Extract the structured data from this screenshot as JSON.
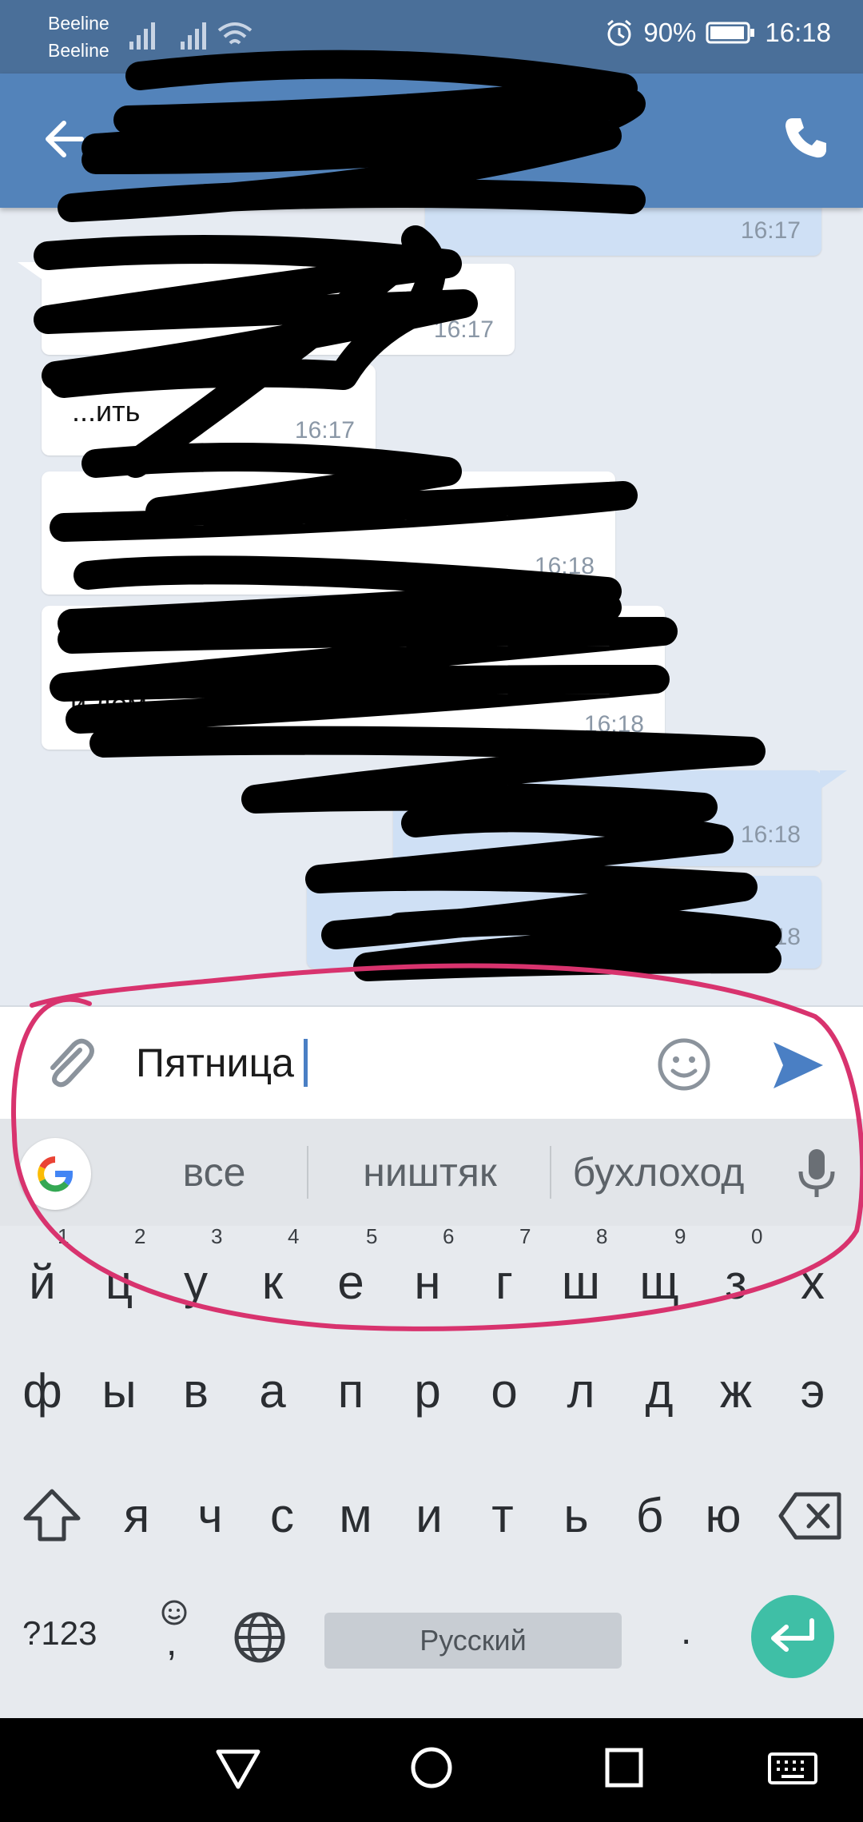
{
  "status_bar": {
    "carrier_1": "Beeline",
    "carrier_2": "Beeline",
    "battery": "90%",
    "time": "16:18"
  },
  "chat": {
    "messages": [
      {
        "type": "outgoing",
        "time": "16:17"
      },
      {
        "type": "incoming",
        "time": "16:17"
      },
      {
        "type": "incoming",
        "text": "...ить",
        "time": "16:17"
      },
      {
        "type": "incoming",
        "time": "16:18"
      },
      {
        "type": "incoming",
        "text": "и дом...",
        "time": "16:18"
      },
      {
        "type": "outgoing",
        "time": "16:18"
      },
      {
        "type": "outgoing",
        "time": "16:18"
      }
    ]
  },
  "composer": {
    "message_text": "Пятница"
  },
  "suggestions": [
    "все",
    "ништяк",
    "бухлоход"
  ],
  "keyboard": {
    "row1": [
      "й",
      "ц",
      "у",
      "к",
      "е",
      "н",
      "г",
      "ш",
      "щ",
      "з",
      "х"
    ],
    "row1_hints": [
      "1",
      "2",
      "3",
      "4",
      "5",
      "6",
      "7",
      "8",
      "9",
      "0"
    ],
    "row2": [
      "ф",
      "ы",
      "в",
      "а",
      "п",
      "р",
      "о",
      "л",
      "д",
      "ж",
      "э"
    ],
    "row3": [
      "я",
      "ч",
      "с",
      "м",
      "и",
      "т",
      "ь",
      "б",
      "ю"
    ],
    "symbols_label": "?123",
    "comma_label": ",",
    "space_label": "Русский",
    "period_label": "."
  },
  "colors": {
    "status_bar": "#4a6f99",
    "app_bar": "#5383ba",
    "chat_background": "#e6ebf2",
    "outgoing_bubble": "#cfe0f5",
    "send_icon": "#4a7fc4",
    "enter_key": "#3fbfa6",
    "annotation_circle": "#d8336e"
  },
  "icons": [
    "back-arrow-icon",
    "phone-icon",
    "attach-icon",
    "emoji-icon",
    "send-icon",
    "google-icon",
    "microphone-icon",
    "shift-icon",
    "backspace-icon",
    "emoji-key-icon",
    "globe-icon",
    "enter-icon",
    "nav-back-icon",
    "nav-home-icon",
    "nav-recents-icon",
    "keyboard-hide-icon"
  ]
}
